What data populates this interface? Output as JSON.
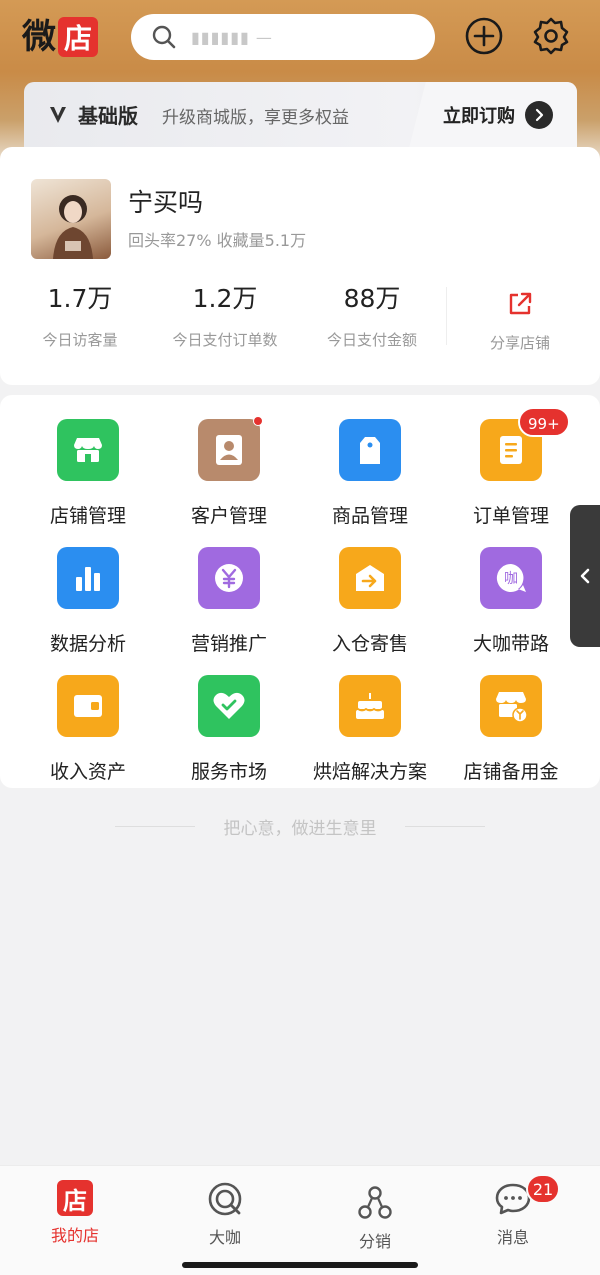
{
  "header": {
    "logo_char1": "微",
    "logo_char2": "店",
    "search_placeholder": "▮▮▮▮▮▮ —"
  },
  "plan": {
    "name": "基础版",
    "desc": "升级商城版，享更多权益",
    "cta": "立即订购"
  },
  "store": {
    "name": "宁买吗",
    "subtitle": "回头率27% 收藏量5.1万",
    "stats": [
      {
        "value": "1.7万",
        "label": "今日访客量"
      },
      {
        "value": "1.2万",
        "label": "今日支付订单数"
      },
      {
        "value": "88万",
        "label": "今日支付金额"
      }
    ],
    "share_label": "分享店铺"
  },
  "grid": {
    "items": [
      {
        "label": "店铺管理",
        "icon": "store-icon",
        "color": "#2fc35f"
      },
      {
        "label": "客户管理",
        "icon": "customer-icon",
        "color": "#b88a6c"
      },
      {
        "label": "商品管理",
        "icon": "product-tag-icon",
        "color": "#2b8ef0"
      },
      {
        "label": "订单管理",
        "icon": "order-doc-icon",
        "color": "#f7a81b",
        "badge": "99+"
      },
      {
        "label": "数据分析",
        "icon": "bar-chart-icon",
        "color": "#2b8ef0"
      },
      {
        "label": "营销推广",
        "icon": "yen-coin-icon",
        "color": "#a06ae0"
      },
      {
        "label": "入仓寄售",
        "icon": "warehouse-in-icon",
        "color": "#f7a81b"
      },
      {
        "label": "大咖带路",
        "icon": "daka-bubble-icon",
        "color": "#a06ae0"
      },
      {
        "label": "收入资产",
        "icon": "wallet-icon",
        "color": "#f7a81b"
      },
      {
        "label": "服务市场",
        "icon": "heart-check-icon",
        "color": "#2fc35f"
      },
      {
        "label": "烘焙解决方案",
        "icon": "cake-icon",
        "color": "#f7a81b"
      },
      {
        "label": "店铺备用金",
        "icon": "store-yen-icon",
        "color": "#f7a81b"
      }
    ]
  },
  "slogan": "把心意，做进生意里",
  "tabbar": {
    "tabs": [
      {
        "label": "我的店",
        "icon": "my-store-icon",
        "icon_char": "店"
      },
      {
        "label": "大咖",
        "icon": "daka-icon"
      },
      {
        "label": "分销",
        "icon": "distribution-icon"
      },
      {
        "label": "消息",
        "icon": "message-icon"
      }
    ],
    "message_badge": "21"
  },
  "colors": {
    "accent_red": "#e5322e",
    "header_gold": "#c98b47"
  }
}
